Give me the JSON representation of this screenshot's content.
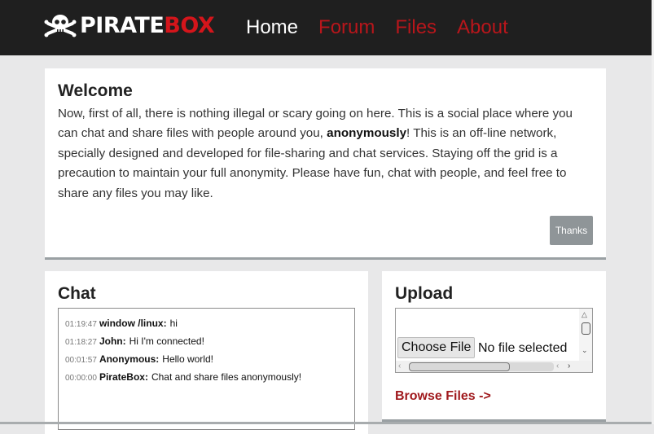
{
  "brand": {
    "part1": "PIRATE",
    "part2": "BOX",
    "colors": {
      "white": "#ffffff",
      "red": "#d4151b"
    }
  },
  "nav": {
    "items": [
      {
        "label": "Home",
        "active": true
      },
      {
        "label": "Forum"
      },
      {
        "label": "Files"
      },
      {
        "label": "About"
      }
    ]
  },
  "welcome": {
    "title": "Welcome",
    "text_before": "Now, first of all, there is nothing illegal or scary going on here. This is a social place where you can chat and share files with people around you, ",
    "text_bold": "anonymously",
    "text_after": "! This is an off-line network, specially designed and developed for file-sharing and chat services. Staying off the grid is a precaution to maintain your full anonymity. Please have fun, chat with people, and feel free to share any files you may like.",
    "button": "Thanks"
  },
  "chat": {
    "title": "Chat",
    "messages": [
      {
        "time": "01:19:47",
        "user": "window /linux:",
        "text": "hi"
      },
      {
        "time": "01:18:27",
        "user": "John:",
        "text": "Hi I'm connected!"
      },
      {
        "time": "00:01:57",
        "user": "Anonymous:",
        "text": "Hello world!"
      },
      {
        "time": "00:00:00",
        "user": "PirateBox:",
        "text": "Chat and share files anonymously!"
      }
    ]
  },
  "upload": {
    "title": "Upload",
    "choose_label": "Choose File",
    "no_file": "No file selected",
    "browse": "Browse Files ->"
  },
  "colors": {
    "header_bg": "#1f1f1f",
    "accent_red": "#b8161b",
    "page_bg": "#e8e8e9",
    "button_gray": "#8f9598"
  }
}
